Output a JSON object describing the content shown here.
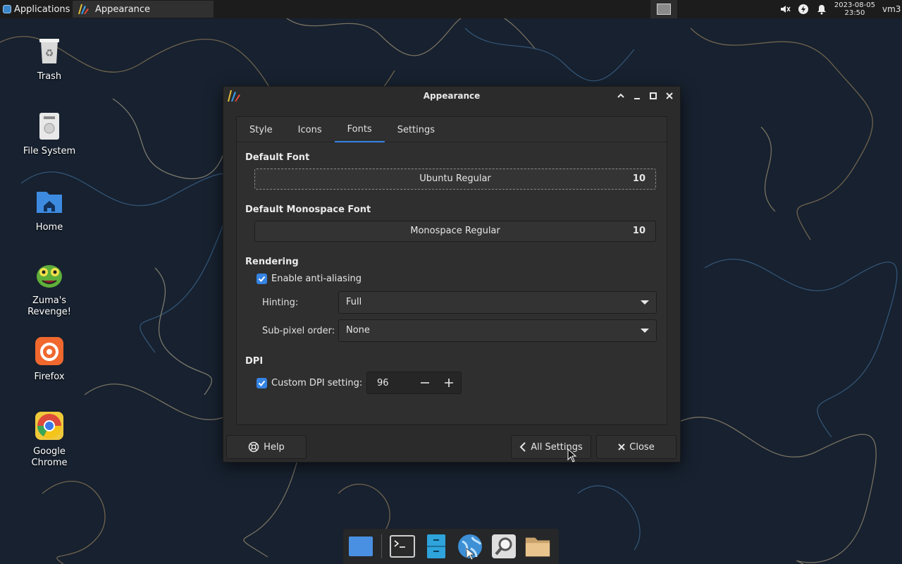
{
  "top_panel": {
    "applications_label": "Applications",
    "window_button_title": "Appearance",
    "clock_date": "2023-08-05",
    "clock_time": "23:50",
    "user": "vm3"
  },
  "desktop_icons": [
    {
      "label": "Trash"
    },
    {
      "label": "File System"
    },
    {
      "label": "Home"
    },
    {
      "label": "Zuma's Revenge!"
    },
    {
      "label": "Firefox"
    },
    {
      "label": "Google Chrome"
    }
  ],
  "dialog": {
    "title": "Appearance",
    "tabs": [
      {
        "label": "Style"
      },
      {
        "label": "Icons"
      },
      {
        "label": "Fonts"
      },
      {
        "label": "Settings"
      }
    ],
    "active_tab": "Fonts",
    "default_font": {
      "heading": "Default Font",
      "name": "Ubuntu Regular",
      "size": "10"
    },
    "monospace_font": {
      "heading": "Default Monospace Font",
      "name": "Monospace Regular",
      "size": "10"
    },
    "rendering": {
      "heading": "Rendering",
      "antialias_label": "Enable anti-aliasing",
      "antialias_checked": true,
      "hinting_label": "Hinting:",
      "hinting_value": "Full",
      "subpixel_label": "Sub-pixel order:",
      "subpixel_value": "None"
    },
    "dpi": {
      "heading": "DPI",
      "custom_label": "Custom DPI setting:",
      "custom_checked": true,
      "value": "96"
    },
    "buttons": {
      "help": "Help",
      "all_settings": "All Settings",
      "close": "Close"
    }
  },
  "colors": {
    "accent": "#3584e4",
    "dialog_bg": "#2b2b2b",
    "panel_bg": "#1c1c1c"
  }
}
